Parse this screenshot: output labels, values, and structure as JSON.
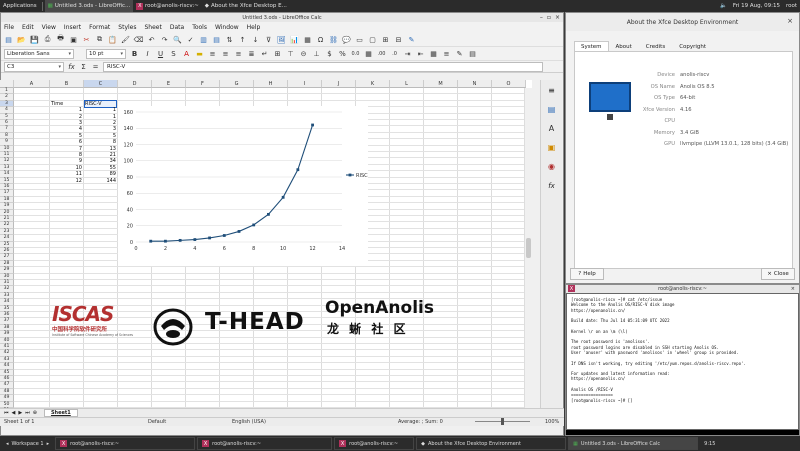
{
  "top_panel": {
    "applications": "Applications",
    "tasks": [
      {
        "label": "Untitled 3.ods - LibreOffic...",
        "active": true
      },
      {
        "label": "root@anolis-riscv:~",
        "active": false
      },
      {
        "label": "About the Xfce Desktop E...",
        "active": false
      }
    ],
    "clock": "Fri 19 Aug, 09:15",
    "user": "root"
  },
  "calc": {
    "title": "Untitled 3.ods - LibreOffice Calc",
    "menu": [
      "File",
      "Edit",
      "View",
      "Insert",
      "Format",
      "Styles",
      "Sheet",
      "Data",
      "Tools",
      "Window",
      "Help"
    ],
    "font_name": "Liberation Sans",
    "font_size": "10 pt",
    "name_box": "C3",
    "formula": "RISC-V",
    "columns": [
      "A",
      "B",
      "C",
      "D",
      "E",
      "F",
      "G",
      "H",
      "I",
      "J",
      "K",
      "L",
      "M",
      "N",
      "O"
    ],
    "rows": [
      "1",
      "2",
      "3",
      "4",
      "5",
      "6",
      "7",
      "8",
      "9",
      "10",
      "11",
      "12",
      "13",
      "14",
      "15",
      "16",
      "17",
      "18",
      "19",
      "20",
      "21",
      "22",
      "23",
      "24",
      "25",
      "26",
      "27",
      "28",
      "29",
      "30",
      "31",
      "32",
      "33",
      "34",
      "35",
      "36",
      "37",
      "38",
      "39",
      "40",
      "41",
      "42",
      "43",
      "44",
      "45",
      "46",
      "47",
      "48",
      "49",
      "50",
      "51"
    ],
    "table": {
      "header_b": "Time",
      "header_c": "RISC-V",
      "times": [
        "1",
        "2",
        "3",
        "4",
        "5",
        "6",
        "7",
        "8",
        "9",
        "10",
        "11",
        "12"
      ],
      "values": [
        "1",
        "1",
        "2",
        "3",
        "5",
        "8",
        "13",
        "21",
        "34",
        "55",
        "89",
        "144"
      ]
    },
    "sheet_tab": "Sheet1",
    "status": {
      "sheet": "Sheet 1 of 1",
      "style": "Default",
      "lang": "English (USA)",
      "calc": "Average: ; Sum: 0",
      "zoom": "100%"
    }
  },
  "chart_data": {
    "type": "line",
    "x": [
      1,
      2,
      3,
      4,
      5,
      6,
      7,
      8,
      9,
      10,
      11,
      12
    ],
    "series": [
      {
        "name": "RISC-V",
        "values": [
          1,
          1,
          2,
          3,
          5,
          8,
          13,
          21,
          34,
          55,
          89,
          144
        ],
        "color": "#1f4e79"
      }
    ],
    "xlim": [
      0,
      14
    ],
    "ylim": [
      0,
      160
    ],
    "xticks": [
      "0",
      "2",
      "4",
      "6",
      "8",
      "10",
      "12",
      "14"
    ],
    "yticks": [
      "0",
      "20",
      "40",
      "60",
      "80",
      "100",
      "120",
      "140",
      "160"
    ],
    "legend": "right",
    "grid": true
  },
  "logos": {
    "iscas": "ISCAS",
    "iscas_cn": "中国科学院软件研究所",
    "iscas_en": "Institute of Software Chinese Academy of Sciences",
    "thead": "T-HEAD",
    "openanolis": "OpenAnolis",
    "openanolis_cn": "龙 蜥 社 区"
  },
  "about": {
    "title": "About the Xfce Desktop Environment",
    "tabs": [
      "System",
      "About",
      "Credits",
      "Copyright"
    ],
    "fields": [
      {
        "k": "Device",
        "v": "anolis-riscv"
      },
      {
        "k": "OS Name",
        "v": "Anolis OS 8.5"
      },
      {
        "k": "OS Type",
        "v": "64-bit"
      },
      {
        "k": "Xfce Version",
        "v": "4.16"
      },
      {
        "k": "CPU",
        "v": ""
      },
      {
        "k": "Memory",
        "v": "3.4 GiB"
      },
      {
        "k": "GPU",
        "v": "llvmpipe (LLVM 13.0.1, 128 bits) (3.4 GiB)"
      }
    ],
    "help": "Help",
    "close": "Close"
  },
  "terminal": {
    "title": "root@anolis-riscv:~",
    "lines": [
      "[root@anolis-riscv ~]# cat /etc/issue",
      "Welcome to the Anolis OS/RISC-V disk image",
      "https://openanolis.cn/",
      "",
      "Build date: Thu Jul 14 05:31:09 UTC 2022",
      "",
      "Kernel \\r on an \\m (\\l)",
      "",
      "The root password is 'anolisos'.",
      "root password logins are disabled in SSH starting Anolis OS.",
      "User 'anuser' with password 'anolisos' in 'wheel' group is provided.",
      "",
      "If DNS isn't working, try editing '/etc/yum.repos.d/anolis-riscv.repo'.",
      "",
      "For updates and latest information read:",
      "https://openanolis.cn/",
      "",
      "Anolis OS /RISC-V",
      "=================",
      "[root@anolis-riscv ~]# []"
    ]
  },
  "taskbar": {
    "workspace": "Workspace 1",
    "items": [
      "root@anolis-riscv:~",
      "root@anolis-riscv:~",
      "root@anolis-riscv:~",
      "About the Xfce Desktop Environment",
      "Untitled 3.ods - LibreOffice Calc"
    ],
    "time": "9:15"
  }
}
